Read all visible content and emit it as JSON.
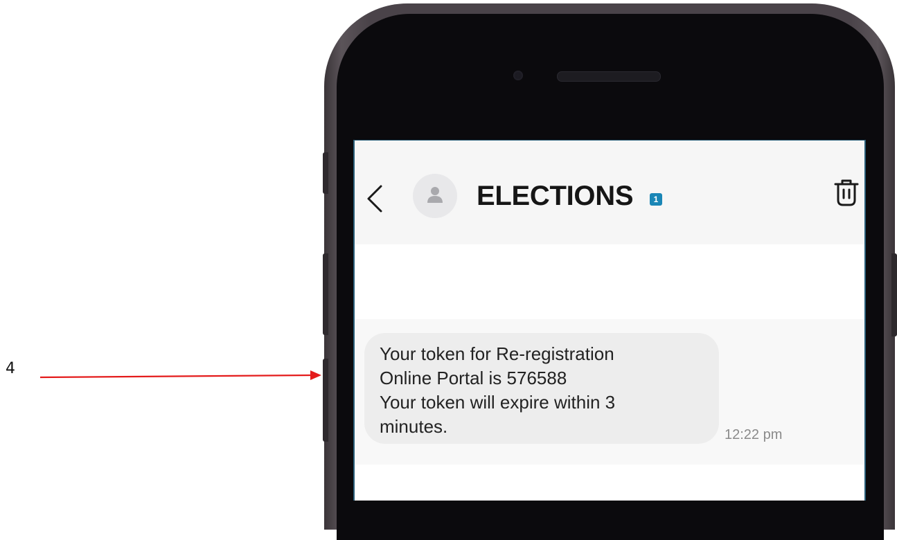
{
  "annotation": {
    "step_number": "4",
    "arrow_color": "#e41b1b"
  },
  "conversation": {
    "title": "ELECTIONS",
    "sim_badge": "1",
    "sim_badge_color": "#1a86b6",
    "back_icon": "chevron-left-icon",
    "avatar_icon": "person-icon",
    "delete_icon": "trash-icon"
  },
  "messages": [
    {
      "lines": [
        "Your token for Re-registration",
        "Online Portal is 576588",
        "Your token will expire within 3",
        "minutes."
      ],
      "time": "12:22 pm"
    }
  ]
}
